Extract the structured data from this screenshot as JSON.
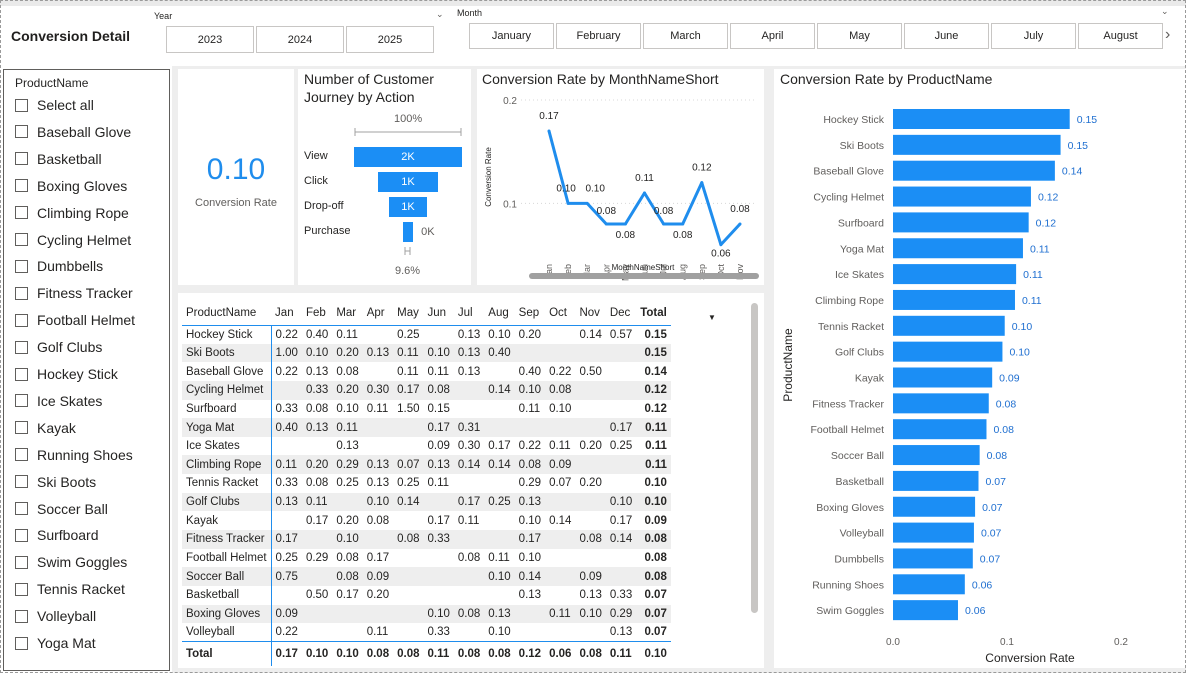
{
  "report": {
    "title": "Conversion Detail"
  },
  "year_slicer": {
    "label": "Year",
    "options": [
      "2023",
      "2024",
      "2025"
    ]
  },
  "month_slicer": {
    "label": "Month",
    "options": [
      "January",
      "February",
      "March",
      "April",
      "May",
      "June",
      "July",
      "August"
    ]
  },
  "product_slicer": {
    "header": "ProductName",
    "items": [
      "Select all",
      "Baseball Glove",
      "Basketball",
      "Boxing Gloves",
      "Climbing Rope",
      "Cycling Helmet",
      "Dumbbells",
      "Fitness Tracker",
      "Football Helmet",
      "Golf Clubs",
      "Hockey Stick",
      "Ice Skates",
      "Kayak",
      "Running Shoes",
      "Ski Boots",
      "Soccer Ball",
      "Surfboard",
      "Swim Goggles",
      "Tennis Racket",
      "Volleyball",
      "Yoga Mat"
    ]
  },
  "card": {
    "value": "0.10",
    "label": "Conversion Rate"
  },
  "funnel": {
    "title_line1": "Number of Customer",
    "title_line2": "Journey by Action",
    "top_pct": "100%",
    "bottom_pct": "9.6%",
    "stages": [
      {
        "label": "View",
        "value_label": "2K",
        "value": 2000
      },
      {
        "label": "Click",
        "value_label": "1K",
        "value": 1100
      },
      {
        "label": "Drop-off",
        "value_label": "1K",
        "value": 700
      },
      {
        "label": "Purchase",
        "value_label": "0K",
        "value": 192
      }
    ]
  },
  "chart_data": [
    {
      "type": "line",
      "title": "Conversion Rate by MonthNameShort",
      "xlabel": "MonthNameShort",
      "ylabel": "Conversion Rate",
      "y_ticks": [
        "0.2",
        "0.1"
      ],
      "ylim": [
        0.05,
        0.2
      ],
      "categories": [
        "Jan",
        "Feb",
        "Mar",
        "Apr",
        "May",
        "Jun",
        "Jul",
        "Aug",
        "Sep",
        "Oct",
        "Nov"
      ],
      "values": [
        0.17,
        0.1,
        0.1,
        0.08,
        0.08,
        0.11,
        0.08,
        0.08,
        0.12,
        0.06,
        0.08
      ],
      "value_labels": [
        "0.17",
        "0.10",
        "0.10",
        "0.08",
        "0.08",
        "0.11",
        "0.08",
        "0.08",
        "0.12",
        "0.06",
        "0.08"
      ],
      "color": "#1f8ded"
    },
    {
      "type": "bar",
      "orientation": "horizontal",
      "title": "Conversion Rate by ProductName",
      "xlabel": "Conversion Rate",
      "ylabel": "ProductName",
      "x_ticks": [
        "0.0",
        "0.1",
        "0.2"
      ],
      "xlim": [
        0,
        0.2
      ],
      "categories": [
        "Hockey Stick",
        "Ski Boots",
        "Baseball Glove",
        "Cycling Helmet",
        "Surfboard",
        "Yoga Mat",
        "Ice Skates",
        "Climbing Rope",
        "Tennis Racket",
        "Golf Clubs",
        "Kayak",
        "Fitness Tracker",
        "Football Helmet",
        "Soccer Ball",
        "Basketball",
        "Boxing Gloves",
        "Volleyball",
        "Dumbbells",
        "Running Shoes",
        "Swim Goggles"
      ],
      "values": [
        0.155,
        0.147,
        0.142,
        0.121,
        0.119,
        0.114,
        0.108,
        0.107,
        0.098,
        0.096,
        0.087,
        0.084,
        0.082,
        0.076,
        0.075,
        0.072,
        0.071,
        0.07,
        0.063,
        0.057
      ],
      "value_labels": [
        "0.15",
        "0.15",
        "0.14",
        "0.12",
        "0.12",
        "0.11",
        "0.11",
        "0.11",
        "0.10",
        "0.10",
        "0.09",
        "0.08",
        "0.08",
        "0.08",
        "0.07",
        "0.07",
        "0.07",
        "0.07",
        "0.06",
        "0.06"
      ],
      "color": "#1b8ef5"
    },
    {
      "type": "table",
      "columns": [
        "ProductName",
        "Jan",
        "Feb",
        "Mar",
        "Apr",
        "May",
        "Jun",
        "Jul",
        "Aug",
        "Sep",
        "Oct",
        "Nov",
        "Dec",
        "Total"
      ],
      "rows": [
        [
          "Hockey Stick",
          "0.22",
          "0.40",
          "0.11",
          "",
          "0.25",
          "",
          "0.13",
          "0.10",
          "0.20",
          "",
          "0.14",
          "0.57",
          "0.15"
        ],
        [
          "Ski Boots",
          "1.00",
          "0.10",
          "0.20",
          "0.13",
          "0.11",
          "0.10",
          "0.13",
          "0.40",
          "",
          "",
          "",
          "",
          "0.15"
        ],
        [
          "Baseball Glove",
          "0.22",
          "0.13",
          "0.08",
          "",
          "0.11",
          "0.11",
          "0.13",
          "",
          "0.40",
          "0.22",
          "0.50",
          "",
          "0.14"
        ],
        [
          "Cycling Helmet",
          "",
          "0.33",
          "0.20",
          "0.30",
          "0.17",
          "0.08",
          "",
          "0.14",
          "0.10",
          "0.08",
          "",
          "",
          "0.12"
        ],
        [
          "Surfboard",
          "0.33",
          "0.08",
          "0.10",
          "0.11",
          "1.50",
          "0.15",
          "",
          "",
          "0.11",
          "0.10",
          "",
          "",
          "0.12"
        ],
        [
          "Yoga Mat",
          "0.40",
          "0.13",
          "0.11",
          "",
          "",
          "0.17",
          "0.31",
          "",
          "",
          "",
          "",
          "0.17",
          "0.11"
        ],
        [
          "Ice Skates",
          "",
          "",
          "0.13",
          "",
          "",
          "0.09",
          "0.30",
          "0.17",
          "0.22",
          "0.11",
          "0.20",
          "0.25",
          "0.11"
        ],
        [
          "Climbing Rope",
          "0.11",
          "0.20",
          "0.29",
          "0.13",
          "0.07",
          "0.13",
          "0.14",
          "0.14",
          "0.08",
          "0.09",
          "",
          "",
          "0.11"
        ],
        [
          "Tennis Racket",
          "0.33",
          "0.08",
          "0.25",
          "0.13",
          "0.25",
          "0.11",
          "",
          "",
          "0.29",
          "0.07",
          "0.20",
          "",
          "0.10"
        ],
        [
          "Golf Clubs",
          "0.13",
          "0.11",
          "",
          "0.10",
          "0.14",
          "",
          "0.17",
          "0.25",
          "0.13",
          "",
          "",
          "0.10",
          "0.10"
        ],
        [
          "Kayak",
          "",
          "0.17",
          "0.20",
          "0.08",
          "",
          "0.17",
          "0.11",
          "",
          "0.10",
          "0.14",
          "",
          "0.17",
          "0.09"
        ],
        [
          "Fitness Tracker",
          "0.17",
          "",
          "0.10",
          "",
          "0.08",
          "0.33",
          "",
          "",
          "0.17",
          "",
          "0.08",
          "0.14",
          "0.08"
        ],
        [
          "Football Helmet",
          "0.25",
          "0.29",
          "0.08",
          "0.17",
          "",
          "",
          "0.08",
          "0.11",
          "0.10",
          "",
          "",
          "",
          "0.08"
        ],
        [
          "Soccer Ball",
          "0.75",
          "",
          "0.08",
          "0.09",
          "",
          "",
          "",
          "0.10",
          "0.14",
          "",
          "0.09",
          "",
          "0.08"
        ],
        [
          "Basketball",
          "",
          "0.50",
          "0.17",
          "0.20",
          "",
          "",
          "",
          "",
          "0.13",
          "",
          "0.13",
          "0.33",
          "0.07"
        ],
        [
          "Boxing Gloves",
          "0.09",
          "",
          "",
          "",
          "",
          "0.10",
          "0.08",
          "0.13",
          "",
          "0.11",
          "0.10",
          "0.29",
          "0.07"
        ],
        [
          "Volleyball",
          "0.22",
          "",
          "",
          "0.11",
          "",
          "0.33",
          "",
          "0.10",
          "",
          "",
          "",
          "0.13",
          "0.07"
        ]
      ],
      "totals": [
        "Total",
        "0.17",
        "0.10",
        "0.10",
        "0.08",
        "0.08",
        "0.11",
        "0.08",
        "0.08",
        "0.12",
        "0.06",
        "0.08",
        "0.11",
        "0.10"
      ]
    }
  ]
}
